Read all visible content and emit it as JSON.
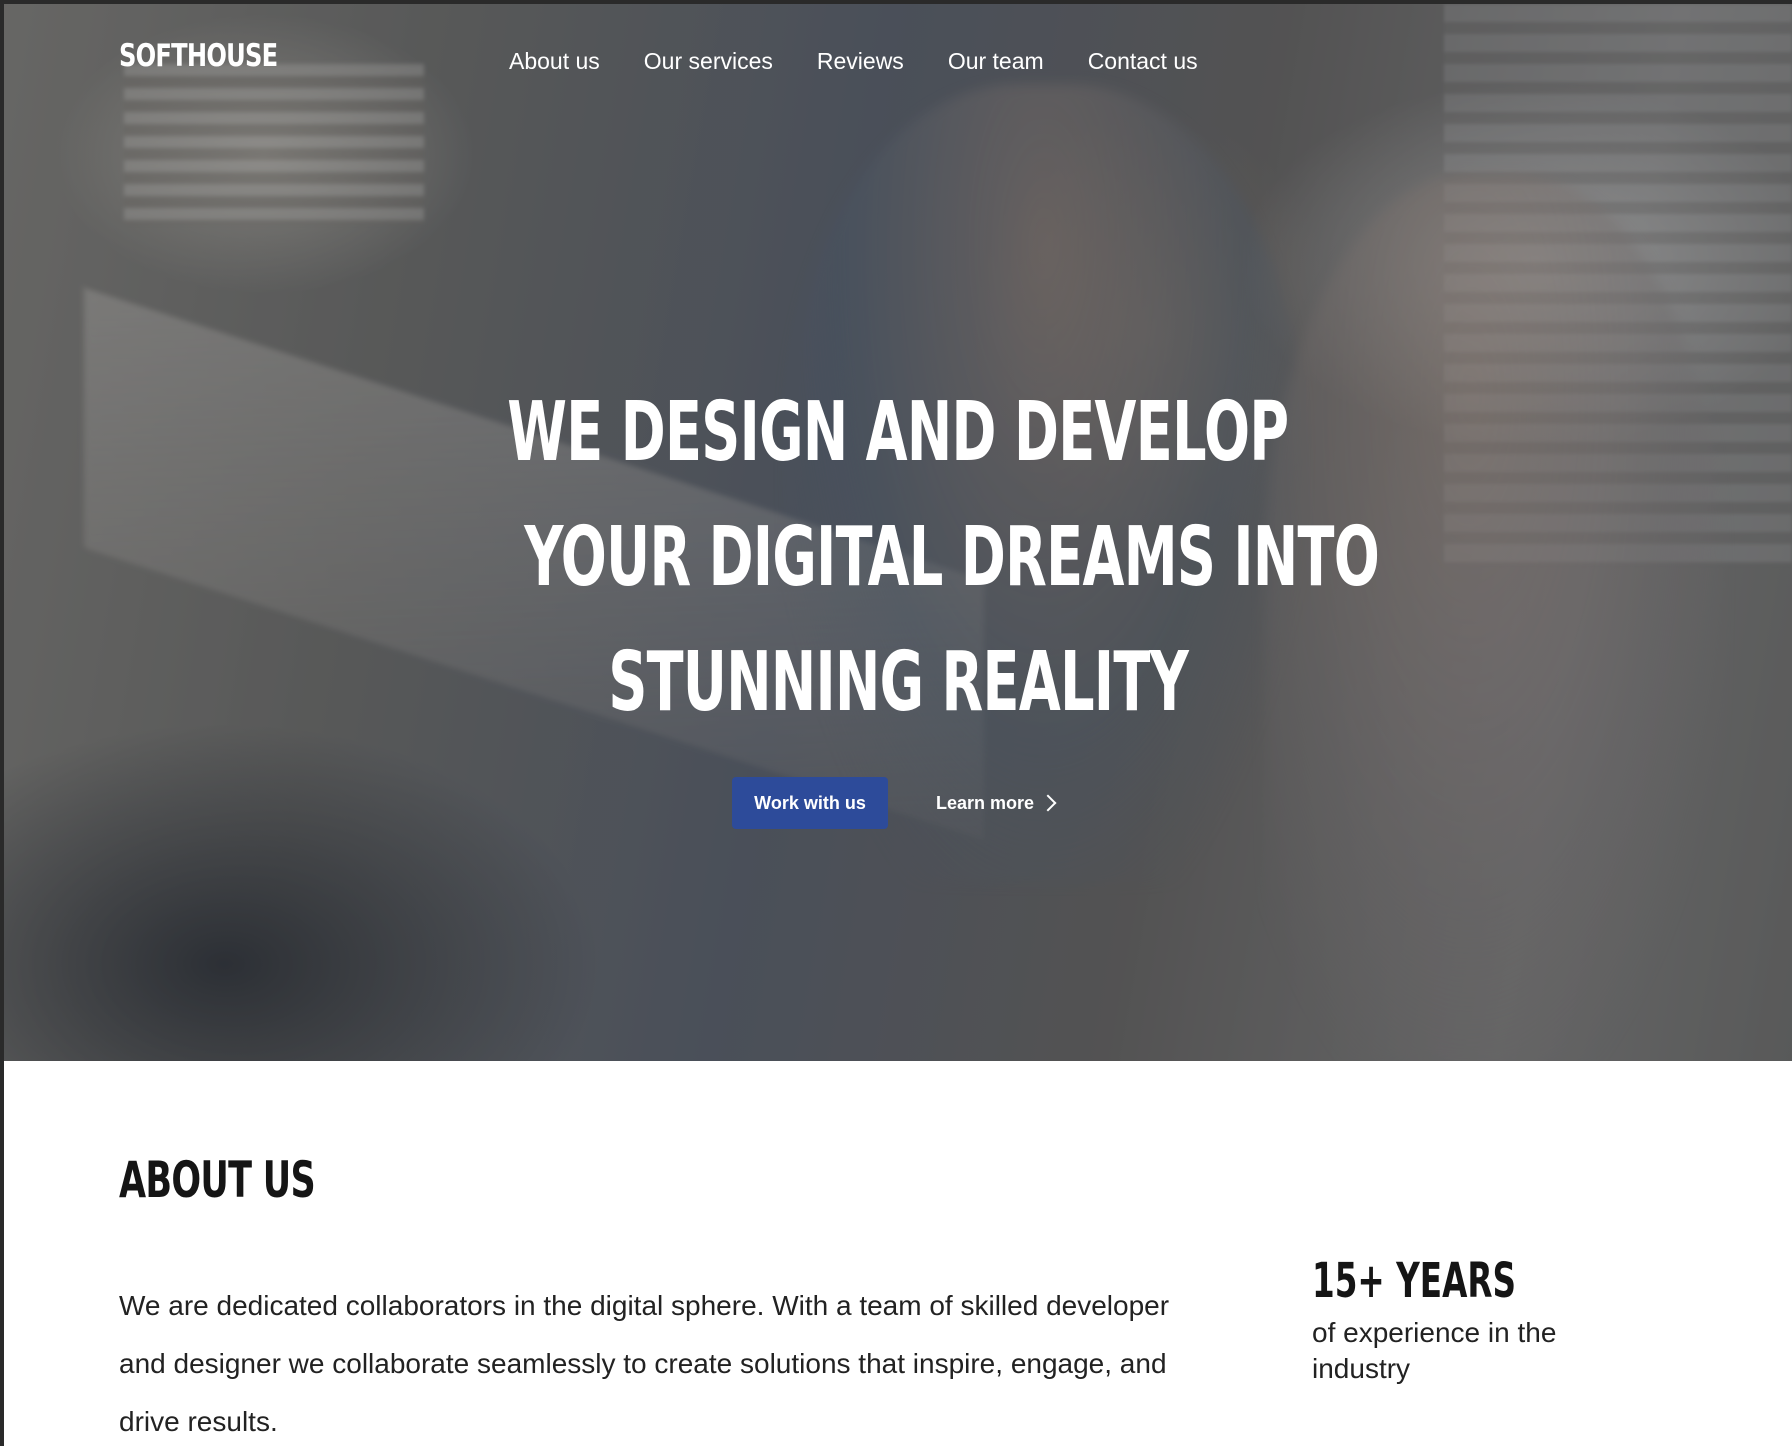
{
  "brand": {
    "logo": "SOFTHOUSE"
  },
  "nav": {
    "items": [
      {
        "label": "About us"
      },
      {
        "label": "Our services"
      },
      {
        "label": "Reviews"
      },
      {
        "label": "Our team"
      },
      {
        "label": "Contact us"
      }
    ]
  },
  "hero": {
    "headline_lines": [
      "WE DESIGN AND DEVELOP",
      "YOUR DIGITAL DREAMS INTO",
      "STUNNING REALITY"
    ],
    "primary_cta": "Work with us",
    "secondary_cta": "Learn more"
  },
  "about": {
    "title": "ABOUT US",
    "body": "We are dedicated collaborators in the digital sphere. With a team of skilled developer and designer we collaborate seamlessly to create solutions that inspire, engage, and drive results.",
    "stat": {
      "value": "15+ YEARS",
      "label": "of experience in the industry"
    }
  },
  "colors": {
    "primary_button": "#2d4b9a",
    "hero_text": "#ffffff",
    "body_text": "#222222",
    "heading_text": "#151515"
  }
}
